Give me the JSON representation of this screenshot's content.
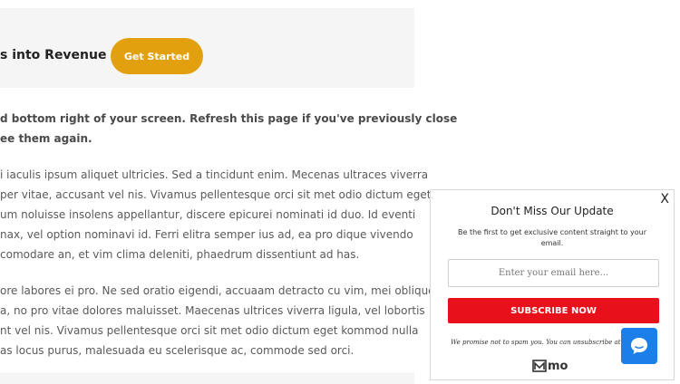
{
  "banner": {
    "title": "s into Revenue",
    "cta_label": "Get Started"
  },
  "content": {
    "intro_lines": [
      "d bottom right of your screen. Refresh this page if you've previously close",
      "ee them again."
    ],
    "paragraph1_lines": [
      "i iaculis ipsum aliquet ultricies. Sed a tincidunt enim. Mecenas ultraces viverra",
      "per vitae, accusant vel nis. Vivamus pellentesque orci sit met odio dictum eget",
      "um noluisse insolens appellantur, discere epicurei nominati id duo. Id eventi",
      "nax, vel option nominavi id. Ferri elitra semper ius ad, ea pro dique vivendo",
      "comodare an, et vim clima deleniti, phaedrum dissentiunt ad has."
    ],
    "paragraph2_lines": [
      "ore labores ei pro. Ne sed oratio eigendi, accuaam detracto cu vim, mei oblique",
      "a, no pro vitae dolores maluisset. Maecenas ultrices viverra ligula, vel lobortis",
      "nt vel nis. Vivamus pellentesque orci sit met odio dictum eget kommod nulla",
      "as locus purus, malesuada eu scelerisque ac, commode sed orci."
    ]
  },
  "popup": {
    "close_label": "X",
    "title": "Don't Miss Our Update",
    "subtitle": "Be the first to get exclusive content straight to your email.",
    "email_placeholder": "Enter your email here...",
    "subscribe_label": "SUBSCRIBE NOW",
    "disclaimer": "We promise not to spam you. You can unsubscribe at any time.",
    "logo_text": "mo"
  },
  "colors": {
    "cta": "#e2a00f",
    "subscribe": "#e8101b",
    "chat": "#1a7fe8"
  },
  "chat": {
    "icon": "chat-bubble-icon"
  }
}
